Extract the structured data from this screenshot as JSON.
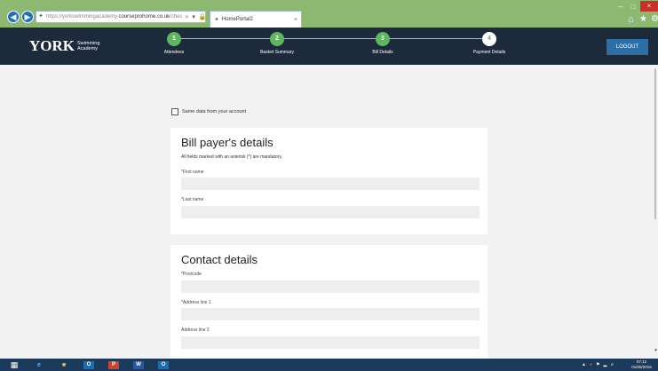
{
  "browser": {
    "url_prefix": "https://yorkswimmingacademy.",
    "url_domain": "courseprohome.co.uk",
    "url_suffix": "/chec",
    "address_tools": "⌕ ▾ 🔒 ↻",
    "tab_title": "HomePortal2",
    "tab_close": "×"
  },
  "window_controls": {
    "minimize": "–",
    "maximize": "□",
    "close": "×"
  },
  "toolbar_icons": {
    "home": "home-icon",
    "favorites": "star-icon",
    "settings": "gear-icon"
  },
  "site": {
    "logo_main": "ORK",
    "logo_y": "Y",
    "logo_line1": "Swimming",
    "logo_line2": "Academy",
    "logout_label": "LOGOUT",
    "steps": [
      {
        "number": "1",
        "label": "Attendees",
        "state": "done"
      },
      {
        "number": "2",
        "label": "Basket Summary",
        "state": "done"
      },
      {
        "number": "3",
        "label": "Bill Details",
        "state": "done"
      },
      {
        "number": "4",
        "label": "Payment Details",
        "state": "current"
      }
    ]
  },
  "form": {
    "same_data_label": "Same data from your account",
    "same_data_checked": false,
    "bill_payer": {
      "title": "Bill payer's details",
      "note": "All fields marked with an asterisk (*) are mandatory.",
      "first_name_label": "*First name",
      "first_name_value": "",
      "last_name_label": "*Last name",
      "last_name_value": ""
    },
    "contact": {
      "title": "Contact details",
      "postcode_label": "*Postcode",
      "postcode_value": "",
      "address1_label": "*Address line 1",
      "address1_value": "",
      "address2_label": "Address line 2",
      "address2_value": ""
    }
  },
  "taskbar": {
    "apps": [
      "start-icon",
      "internet-explorer-icon",
      "file-explorer-icon",
      "outlook-icon",
      "powerpoint-icon",
      "word-icon",
      "outlook-icon"
    ],
    "tray_icons": [
      "arrow-up-icon",
      "network-icon",
      "flag-icon",
      "signal-icon",
      "volume-icon"
    ],
    "time": "07:12",
    "date": "01/05/2016"
  },
  "colors": {
    "chrome_bg": "#8cb872",
    "header_bg": "#1d2a3c",
    "step_done": "#5cb85c",
    "logout_bg": "#2d6ea6",
    "page_bg": "#f2f2f2",
    "input_bg": "#eeeeee",
    "taskbar_bg": "#1b3a5c"
  }
}
